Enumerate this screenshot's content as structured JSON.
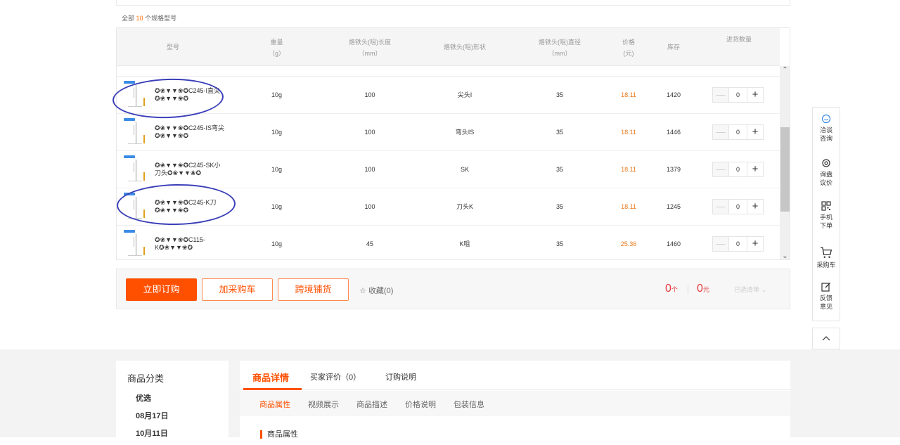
{
  "summary": {
    "prefix": "全部",
    "count": "10",
    "suffix": "个规格型号"
  },
  "table": {
    "headers": {
      "model": "型号",
      "weight": "重量",
      "weight_unit": "（g）",
      "length": "烙铁头(咀)长度",
      "length_unit": "（mm）",
      "shape": "烙铁头(咀)形状",
      "diameter": "烙铁头(咀)直径",
      "diameter_unit": "（mm）",
      "price": "价格",
      "price_unit": "(元)",
      "stock": "库存",
      "qty": "进货数量"
    },
    "rows": [
      {
        "name": "✪❀▼▼❀✪C245-I直尖✪❀▼▼❀✪",
        "weight": "10g",
        "length": "100",
        "shape": "尖头I",
        "diameter": "35",
        "price": "18.11",
        "stock": "1420",
        "qty": "0"
      },
      {
        "name": "✪❀▼▼❀✪C245-IS弯尖✪❀▼▼❀✪",
        "weight": "10g",
        "length": "100",
        "shape": "弯头IS",
        "diameter": "35",
        "price": "18.11",
        "stock": "1446",
        "qty": "0"
      },
      {
        "name": "✪❀▼▼❀✪C245-SK小刀头✪❀▼▼❀✪",
        "weight": "10g",
        "length": "100",
        "shape": "SK",
        "diameter": "35",
        "price": "18.11",
        "stock": "1379",
        "qty": "0"
      },
      {
        "name": "✪❀▼▼❀✪C245-K刀✪❀▼▼❀✪",
        "weight": "10g",
        "length": "100",
        "shape": "刀头K",
        "diameter": "35",
        "price": "18.11",
        "stock": "1245",
        "qty": "0"
      },
      {
        "name": "✪❀▼▼❀✪C115-K✪❀▼▼❀✪",
        "weight": "10g",
        "length": "45",
        "shape": "K咀",
        "diameter": "35",
        "price": "25.36",
        "stock": "1460",
        "qty": "0"
      }
    ],
    "stepper": {
      "minus": "—",
      "plus": "+"
    }
  },
  "actions": {
    "buy_now": "立即订购",
    "add_cart": "加采购车",
    "cross_border": "跨境铺货",
    "favorite": "收藏(0)",
    "count_qty": "0",
    "count_qty_unit": "个",
    "count_price": "0",
    "count_price_unit": "元",
    "selected_list": "已选清单"
  },
  "sidebar": {
    "chat": "洽谈咨询",
    "inquiry": "询盘议价",
    "mobile": "手机下单",
    "cart": "采购车",
    "feedback": "反馈意见"
  },
  "category": {
    "title": "商品分类",
    "items": [
      "优选",
      "08月17日",
      "10月11日"
    ]
  },
  "detail": {
    "tabs": [
      "商品详情",
      "买家评价（0）",
      "订购说明"
    ],
    "subtabs": [
      "商品属性",
      "视频展示",
      "商品描述",
      "价格说明",
      "包装信息"
    ],
    "section_title": "商品属性"
  },
  "colors": {
    "accent": "#ff5000",
    "price": "#e8791c",
    "highlight": "#3a3fb8"
  }
}
